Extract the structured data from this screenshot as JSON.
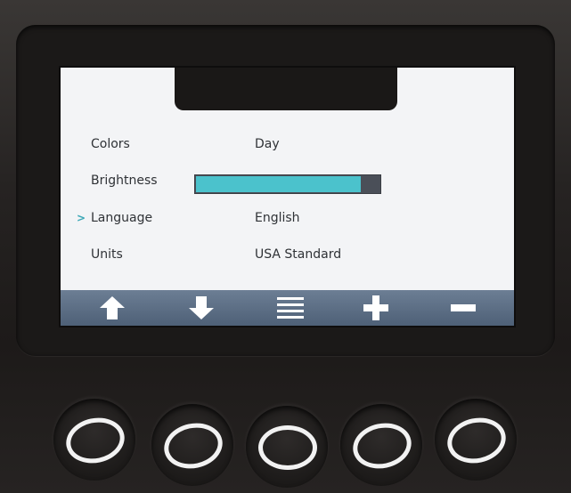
{
  "settings": {
    "rows": [
      {
        "label": "Colors",
        "value": "Day"
      },
      {
        "label": "Brightness",
        "level": 0.9
      },
      {
        "label": "Language",
        "value": "English",
        "selected": true
      },
      {
        "label": "Units",
        "value": "USA Standard"
      }
    ]
  },
  "toolbar": {
    "buttons": [
      "up-arrow-icon",
      "down-arrow-icon",
      "menu-icon",
      "plus-icon",
      "minus-icon"
    ]
  },
  "colors": {
    "screen_bg": "#f3f4f6",
    "accent": "#4bc2cc",
    "toolbar": "#5b6d84",
    "cursor": "#3aa7b6"
  }
}
